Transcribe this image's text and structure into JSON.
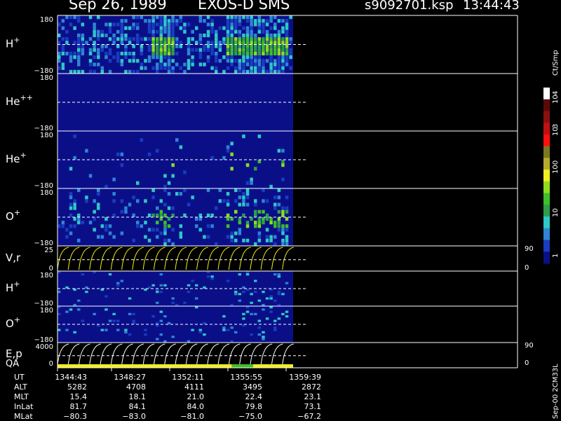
{
  "header": {
    "date": "Sep 26, 1989",
    "instrument": "EXOS-D SMS",
    "file": "s9092701.ksp",
    "time": "13:44:43"
  },
  "colorbar": {
    "unit_label": "Ct/Smp",
    "ticks": [
      "1",
      "10",
      "100",
      "10",
      "3",
      "10",
      "4"
    ],
    "colors": [
      "#0a0f88",
      "#1a3cc0",
      "#2f84d4",
      "#2dc9c6",
      "#2d9e4b",
      "#3fbf28",
      "#8fdc20",
      "#f0ee20",
      "#b8a830",
      "#7a7820",
      "#ff1010",
      "#c01010",
      "#8a1010",
      "#5a0a0a",
      "#ffffff"
    ]
  },
  "footer_id": "Sep-00 2CM33L",
  "chart_data": {
    "type": "heatmap",
    "time_axis": {
      "label": "UT",
      "ticks": [
        "1344:43",
        "1348:27",
        "1352:11",
        "1355:55",
        "1359:39"
      ]
    },
    "panels": [
      {
        "label": "H",
        "sup": "+",
        "y_top": "180",
        "y_bottom": "−180",
        "kind": "spectrogram",
        "activity": "high"
      },
      {
        "label": "He",
        "sup": "++",
        "y_top": "180",
        "y_bottom": "−180",
        "kind": "spectrogram",
        "activity": "none"
      },
      {
        "label": "He",
        "sup": "+",
        "y_top": "180",
        "y_bottom": "−180",
        "kind": "spectrogram",
        "activity": "low"
      },
      {
        "label": "O",
        "sup": "+",
        "y_top": "180",
        "y_bottom": "−180",
        "kind": "spectrogram",
        "activity": "medium"
      },
      {
        "label": "V,r",
        "sup": "",
        "y_top": "25",
        "y_bottom": "0",
        "right_top": "90",
        "right_bottom": "0",
        "kind": "sweep"
      },
      {
        "label": "H",
        "sup": "+",
        "y_top": "180",
        "y_bottom": "−180",
        "kind": "spectrogram",
        "activity": "sparse"
      },
      {
        "label": "O",
        "sup": "+",
        "y_top": "180",
        "y_bottom": "−180",
        "kind": "spectrogram",
        "activity": "sparse"
      },
      {
        "label": "E,p",
        "sup": "",
        "y_top": "4000",
        "y_bottom": "0",
        "right_top": "90",
        "right_bottom": "0",
        "kind": "sweep"
      }
    ],
    "qa": {
      "label": "QA",
      "segments": [
        {
          "from": 0.0,
          "to": 0.74,
          "color": "#f0ee20"
        },
        {
          "from": 0.74,
          "to": 0.83,
          "color": "#3fbf28"
        },
        {
          "from": 0.83,
          "to": 1.0,
          "color": "#f0ee20"
        }
      ]
    },
    "ephemeris": [
      {
        "label": "UT",
        "values": [
          "1344:43",
          "1348:27",
          "1352:11",
          "1355:55",
          "1359:39"
        ]
      },
      {
        "label": "ALT",
        "values": [
          "5282",
          "4708",
          "4111",
          "3495",
          "2872"
        ]
      },
      {
        "label": "MLT",
        "values": [
          "15.4",
          "18.1",
          "21.0",
          "22.4",
          "23.1"
        ]
      },
      {
        "label": "InLat",
        "values": [
          "81.7",
          "84.1",
          "84.0",
          "79.8",
          "73.1"
        ]
      },
      {
        "label": "MLat",
        "values": [
          "−80.3",
          "−83.0",
          "−81.0",
          "−75.0",
          "−67.2"
        ]
      }
    ]
  }
}
